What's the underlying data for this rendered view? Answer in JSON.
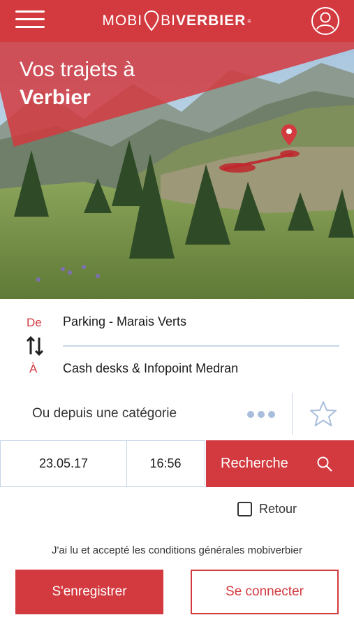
{
  "header": {
    "logo_light": "MOBI",
    "logo_bold": "VERBIER",
    "logo_mark": "≡",
    "brand_color": "#d33a3f"
  },
  "hero": {
    "title_line1": "Vos trajets à",
    "title_line2": "Verbier"
  },
  "route": {
    "from_label": "De",
    "to_label": "À",
    "from_value": "Parking - Marais Verts",
    "to_value": "Cash desks & Infopoint Medran"
  },
  "category": {
    "label": "Ou depuis une catégorie"
  },
  "datetime": {
    "date": "23.05.17",
    "time": "16:56",
    "search_label": "Recherche"
  },
  "retour": {
    "label": "Retour",
    "checked": false
  },
  "terms": {
    "text": "J'ai lu et accepté les conditions générales mobiverbier"
  },
  "actions": {
    "register_label": "S'enregistrer",
    "login_label": "Se connecter"
  }
}
